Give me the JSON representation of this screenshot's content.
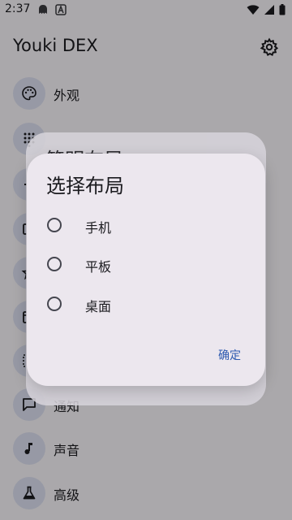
{
  "status_bar": {
    "time": "2:37",
    "icons": [
      "ghost-icon",
      "font-a-icon",
      "wifi-icon",
      "signal-icon",
      "battery-icon"
    ]
  },
  "app_bar": {
    "title": "Youki DEX",
    "settings_icon": "gear-icon"
  },
  "settings_list": {
    "items": [
      {
        "icon": "palette-icon",
        "label": "外观"
      },
      {
        "icon": "dialpad-icon",
        "label": ""
      },
      {
        "icon": "generic-icon",
        "label": ""
      },
      {
        "icon": "window-icon",
        "label": ""
      },
      {
        "icon": "star-icon",
        "label": ""
      },
      {
        "icon": "calendar-icon",
        "label": ""
      },
      {
        "icon": "grid-icon",
        "label": ""
      },
      {
        "icon": "chat-icon",
        "label": "通知"
      },
      {
        "icon": "music-note-icon",
        "label": "声音"
      },
      {
        "icon": "flask-icon",
        "label": "高级"
      }
    ]
  },
  "ghost_dialog": {
    "title": "简明布局"
  },
  "dialog": {
    "title": "选择布局",
    "options": [
      {
        "label": "手机",
        "selected": false
      },
      {
        "label": "平板",
        "selected": false
      },
      {
        "label": "桌面",
        "selected": false
      }
    ],
    "confirm_label": "确定"
  },
  "colors": {
    "background": "#fbf8fc",
    "icon_circle": "#dfe2f3",
    "dialog_bg": "#ece7ee",
    "accent": "#2e5ab0",
    "scrim": "rgba(0,0,0,0.32)"
  }
}
